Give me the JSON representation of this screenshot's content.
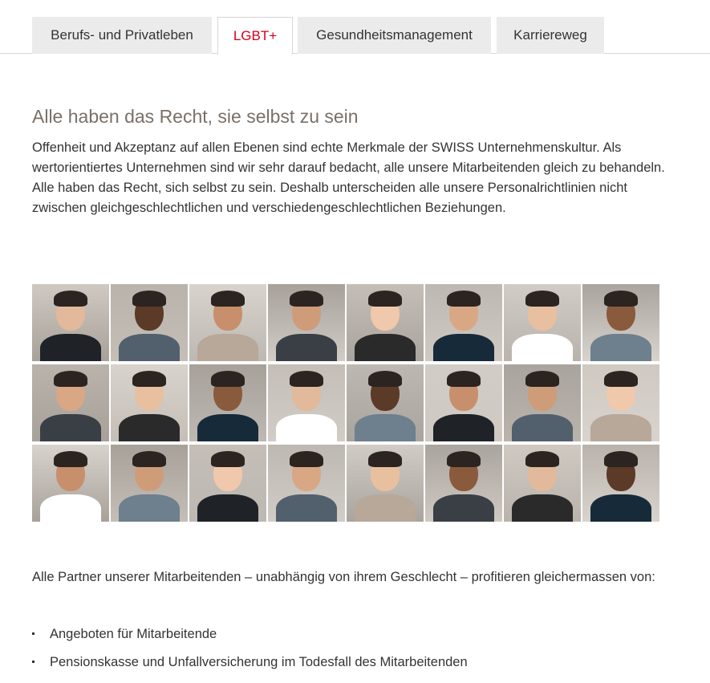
{
  "tabs": [
    {
      "label": "Berufs- und Privatleben",
      "active": false
    },
    {
      "label": "LGBT+",
      "active": true
    },
    {
      "label": "Gesundheitsmanagement",
      "active": false
    },
    {
      "label": "Karriereweg",
      "active": false
    }
  ],
  "section": {
    "title": "Alle haben das Recht, sie selbst zu sein",
    "intro": "Offenheit und Akzeptanz auf allen Ebenen sind echte Merkmale der SWISS Unternehmenskultur. Als wertorientiertes Unternehmen sind wir sehr darauf bedacht, alle unsere Mitarbeitenden gleich zu behandeln. Alle haben das Recht, sich selbst zu sein. Deshalb unterscheiden alle unsere Personalrichtlinien nicht zwischen gleichgeschlechtlichen und verschiedengeschlechtlichen Beziehungen.",
    "outro": "Alle Partner unserer Mitarbeitenden – unabhängig von ihrem Geschlecht – profitieren gleichermassen von:",
    "bullets": [
      "Angeboten für Mitarbeitende",
      "Pensionskasse und Unfallversicherung im Todesfall des Mitarbeitenden"
    ]
  },
  "colors": {
    "accent": "#d4001a",
    "title": "#7a7068",
    "tab_bg": "#ebebeb"
  }
}
